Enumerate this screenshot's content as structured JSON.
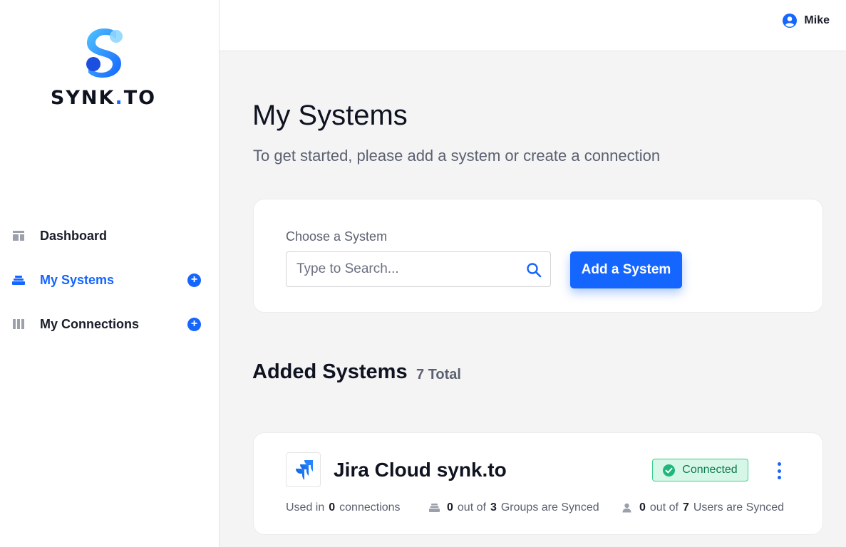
{
  "brand": {
    "name_prefix": "SYNK",
    "name_dot": ".",
    "name_suffix": "TO",
    "accent": "#1565ff"
  },
  "sidebar": {
    "items": [
      {
        "label": "Dashboard",
        "icon": "dashboard-icon",
        "active": false,
        "add": false
      },
      {
        "label": "My Systems",
        "icon": "systems-stack-icon",
        "active": true,
        "add": true
      },
      {
        "label": "My Connections",
        "icon": "columns-icon",
        "active": false,
        "add": true
      }
    ],
    "add_glyph": "+"
  },
  "header": {
    "user_name": "Mike",
    "user_icon": "user-circle-icon"
  },
  "main": {
    "title": "My Systems",
    "subtitle": "To get started, please add a system or create a connection",
    "chooser": {
      "label": "Choose a System",
      "placeholder": "Type to Search...",
      "value": "",
      "button_label": "Add a System"
    },
    "added": {
      "title": "Added Systems",
      "total": "7 Total"
    },
    "systems": [
      {
        "name": "Jira Cloud synk.to",
        "logo_icon": "jira-logo-icon",
        "status": "Connected",
        "status_color": "#0c7a4c",
        "used_prefix": "Used in",
        "used_count": "0",
        "used_suffix": "connections",
        "groups_synced": "0",
        "groups_mid": "out of",
        "groups_total": "3",
        "groups_suffix": "Groups are Synced",
        "users_synced": "0",
        "users_mid": "out of",
        "users_total": "7",
        "users_suffix": "Users are Synced"
      }
    ]
  }
}
